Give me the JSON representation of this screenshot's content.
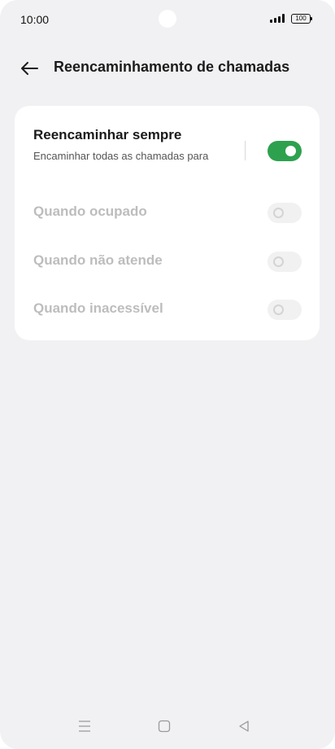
{
  "status_bar": {
    "time": "10:00",
    "battery": "100"
  },
  "header": {
    "back_icon": "arrow-left-icon",
    "title": "Reencaminhamento de chamadas"
  },
  "card": {
    "always": {
      "title": "Reencaminhar sempre",
      "subtitle": "Encaminhar todas as chamadas para",
      "toggle_state": "on"
    },
    "options": [
      {
        "label": "Quando ocupado",
        "toggle_state": "off"
      },
      {
        "label": "Quando não atende",
        "toggle_state": "off"
      },
      {
        "label": "Quando inacessível",
        "toggle_state": "off"
      }
    ]
  },
  "nav_bar": {
    "icons": [
      "menu-icon",
      "home-square-icon",
      "back-triangle-icon"
    ]
  },
  "colors": {
    "accent_green": "#2ea14f",
    "background": "#f1f1f3",
    "disabled_text": "#bdbdbd"
  }
}
